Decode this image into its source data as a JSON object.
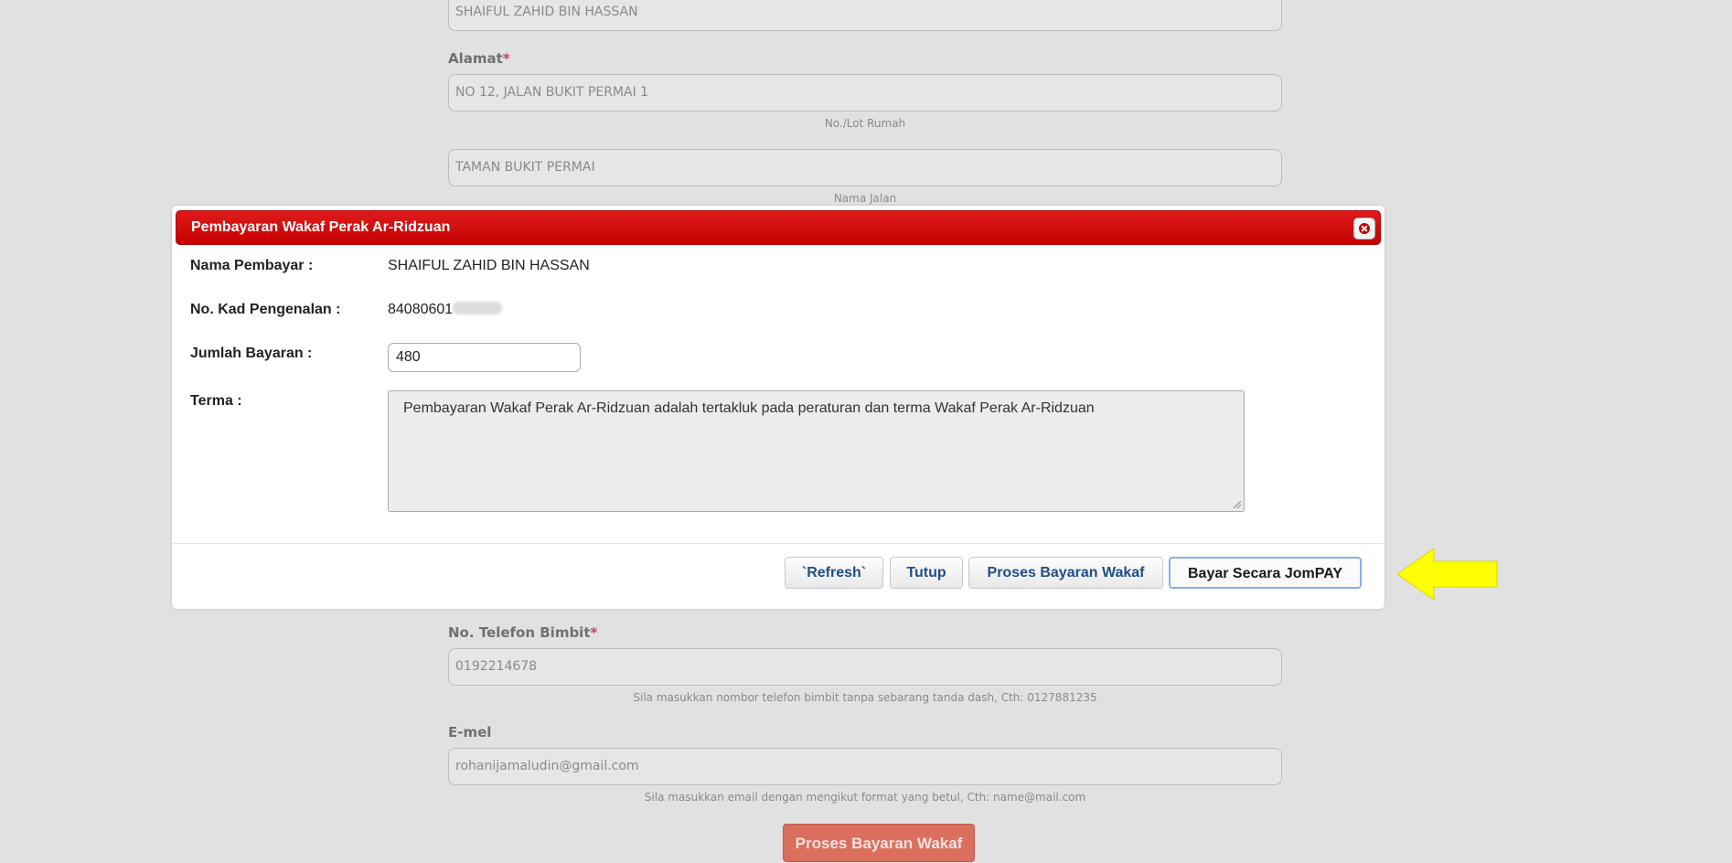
{
  "background_form": {
    "name_value": "SHAIFUL ZAHID BIN HASSAN",
    "address_label": "Alamat",
    "required_mark": "*",
    "address_line1": "NO 12, JALAN BUKIT PERMAI 1",
    "address_line1_help": "No./Lot Rumah",
    "address_line2": "TAMAN BUKIT PERMAI",
    "address_line2_help": "Nama Jalan",
    "phone_label": "No. Telefon Bimbit",
    "phone_value": "0192214678",
    "phone_help": "Sila masukkan nombor telefon bimbit tanpa sebarang tanda dash, Cth: 0127881235",
    "email_label": "E-mel",
    "email_value": "rohanijamaludin@gmail.com",
    "email_help": "Sila masukkan email dengan mengikut format yang betul, Cth: name@mail.com",
    "submit_label": "Proses Bayaran Wakaf"
  },
  "modal": {
    "title": "Pembayaran Wakaf Perak Ar-Ridzuan",
    "payer_label": "Nama Pembayar :",
    "payer_value": "SHAIFUL ZAHID BIN HASSAN",
    "ic_label": "No. Kad Pengenalan :",
    "ic_value_visible": "84080601",
    "amount_label": "Jumlah Bayaran :",
    "amount_value": "480",
    "terms_label": "Terma :",
    "terms_text": "Pembayaran Wakaf Perak Ar-Ridzuan adalah tertakluk pada peraturan dan terma Wakaf Perak Ar-Ridzuan",
    "buttons": {
      "refresh": "`Refresh`",
      "close": "Tutup",
      "process": "Proses Bayaran Wakaf",
      "jompay": "Bayar Secara JomPAY"
    }
  },
  "colors": {
    "header_red": "#c60000",
    "arrow_yellow": "#ffff00",
    "button_text_blue": "#1f4f86"
  }
}
